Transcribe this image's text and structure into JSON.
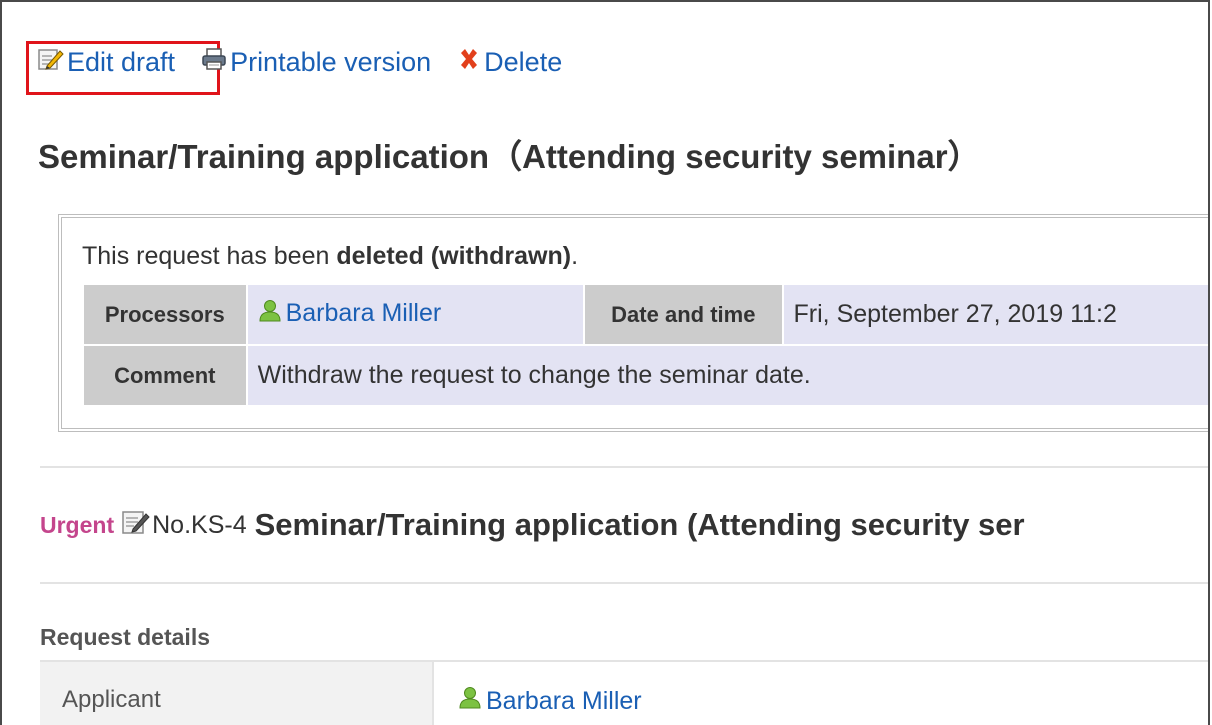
{
  "toolbar": {
    "edit_label": "Edit draft",
    "print_label": "Printable version",
    "delete_label": "Delete"
  },
  "page": {
    "title": "Seminar/Training application（Attending security seminar）"
  },
  "status": {
    "message_prefix": "This request has been ",
    "message_bold": "deleted (withdrawn)",
    "message_suffix": ".",
    "processors_label": "Processors",
    "processor_name": "Barbara Miller",
    "datetime_label": "Date and time",
    "datetime_value": "Fri, September 27, 2019 11:2",
    "comment_label": "Comment",
    "comment_value": "Withdraw the request to change the seminar date."
  },
  "request": {
    "priority": "Urgent",
    "number": "No.KS-4",
    "title": "Seminar/Training application (Attending security ser"
  },
  "details": {
    "heading": "Request details",
    "applicant_label": "Applicant",
    "applicant_name": "Barbara Miller"
  },
  "colors": {
    "link": "#1a5fb4",
    "highlight": "#e0141a",
    "urgent": "#c4458c"
  }
}
